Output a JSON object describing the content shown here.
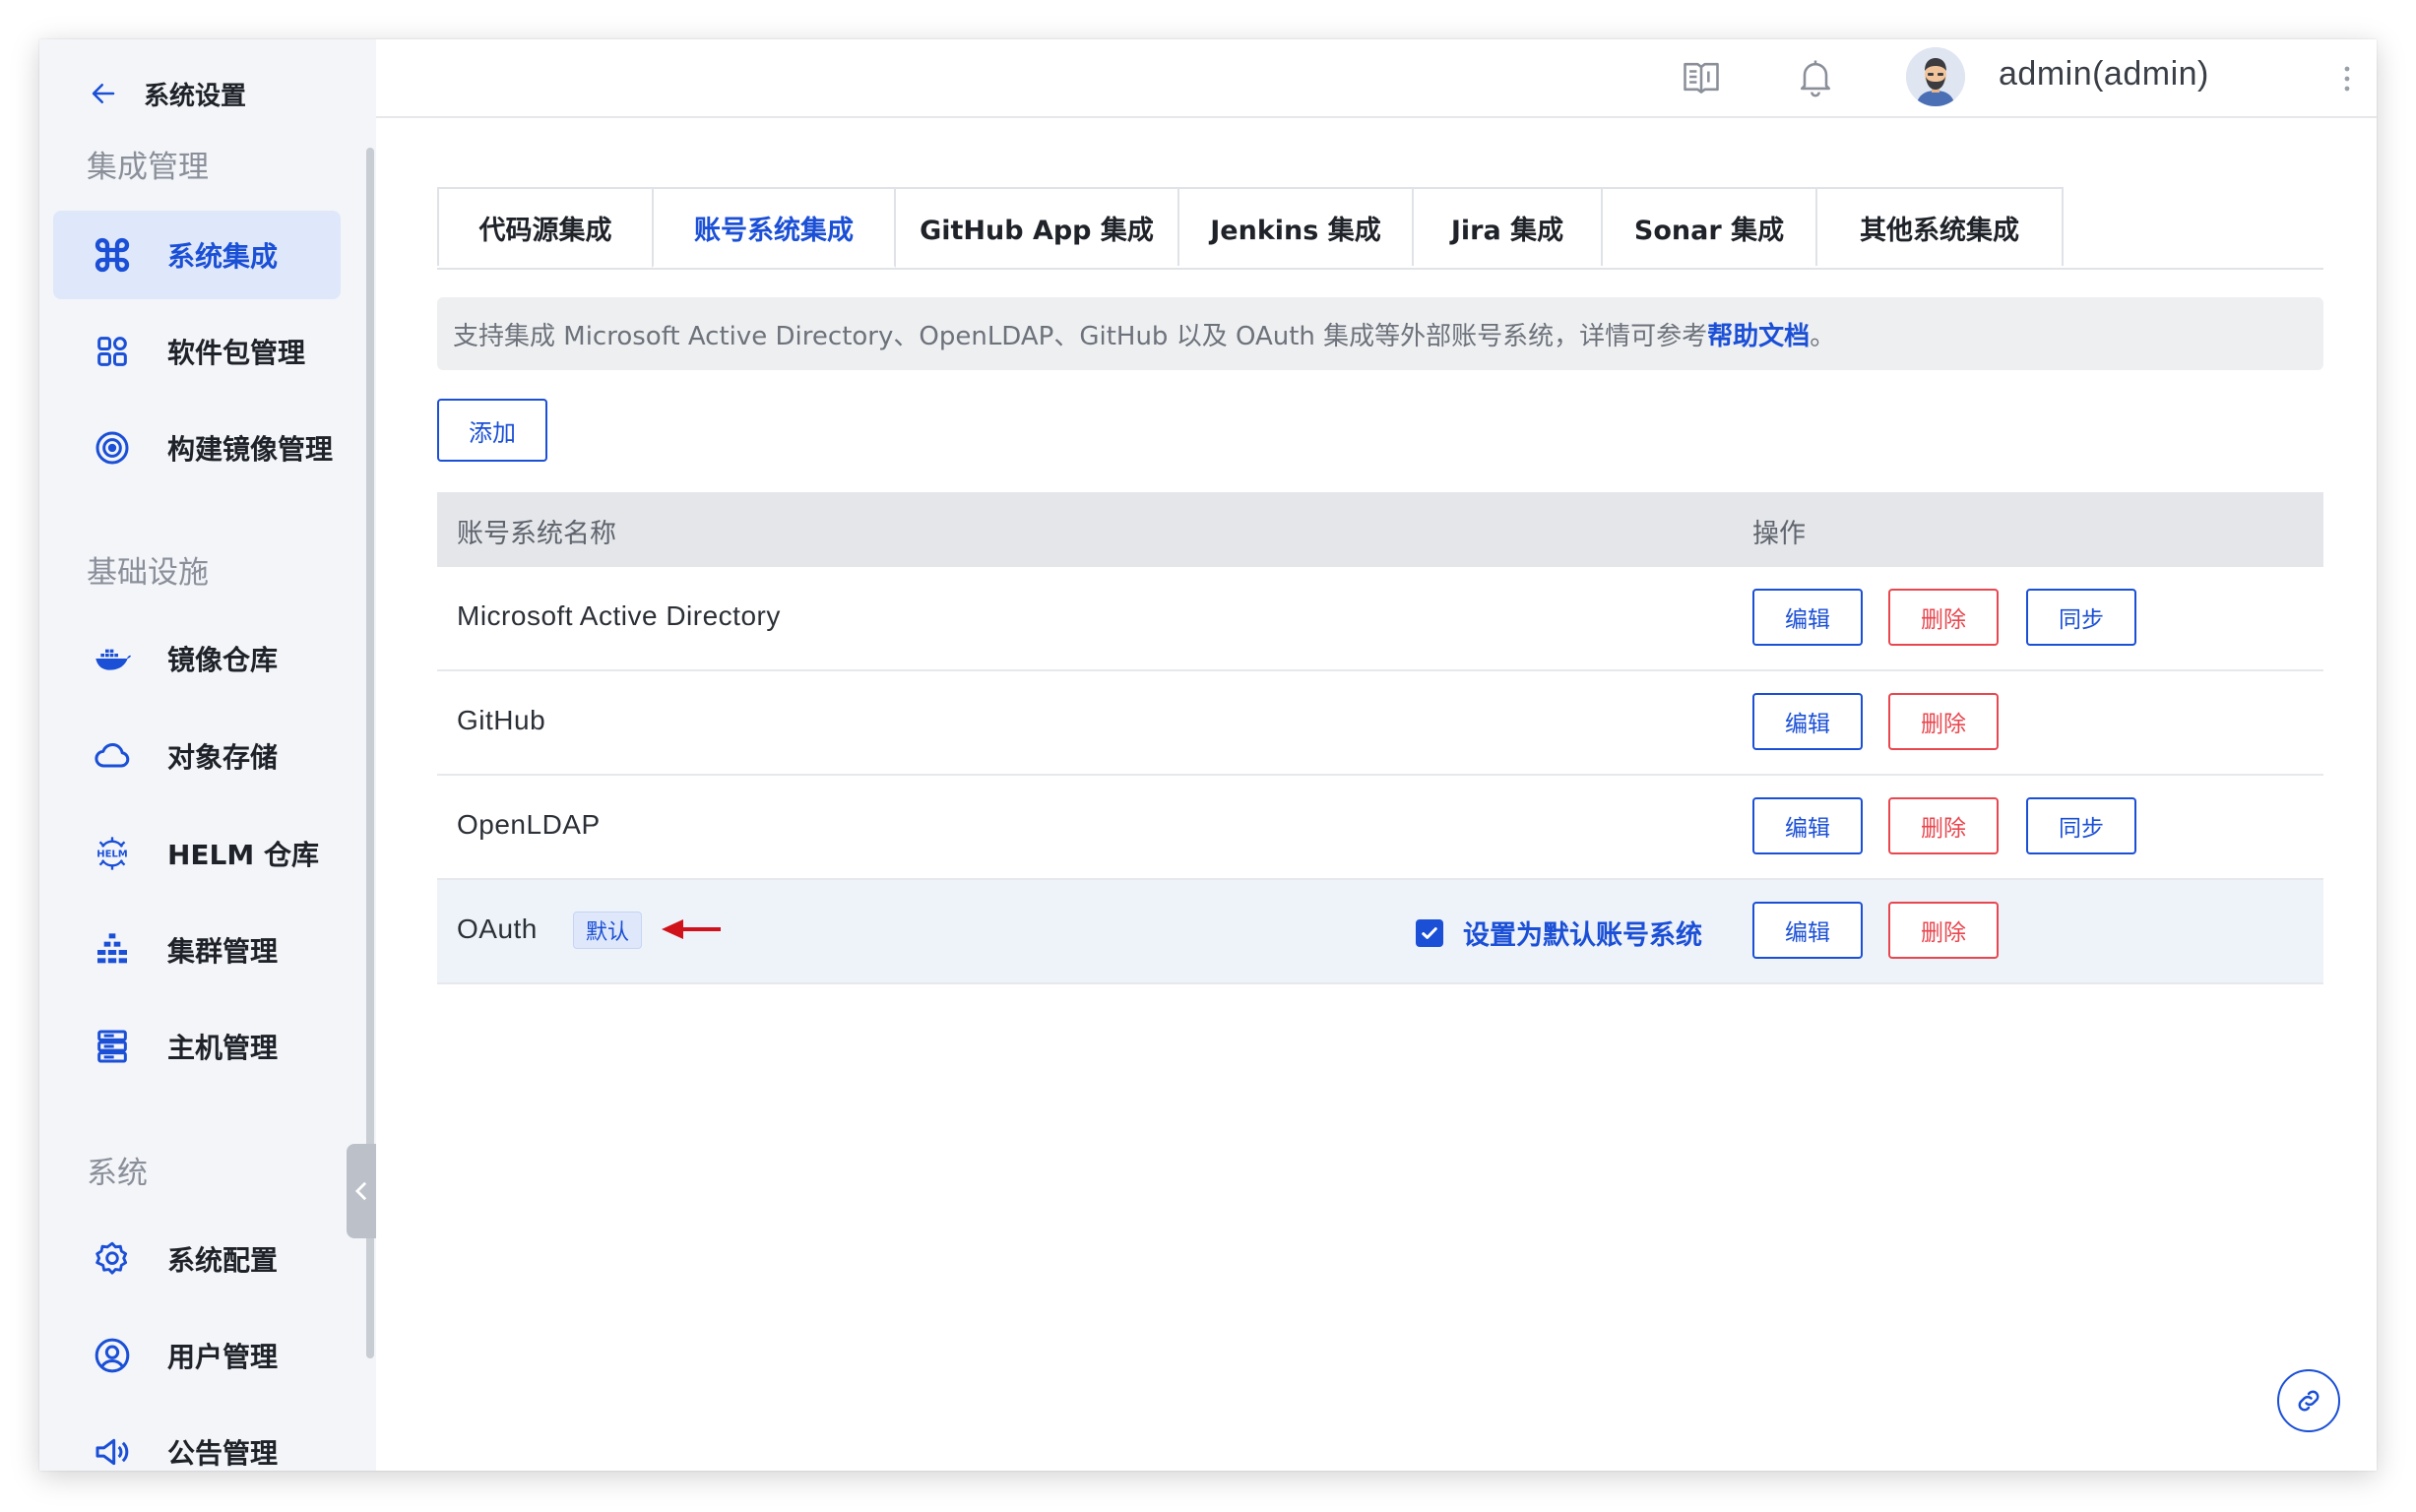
{
  "sidebar": {
    "back_label": "系统设置",
    "sections": [
      {
        "title": "集成管理"
      },
      {
        "title": "基础设施"
      },
      {
        "title": "系统"
      }
    ],
    "items": [
      {
        "label": "系统集成",
        "icon": "command-icon",
        "active": true
      },
      {
        "label": "软件包管理",
        "icon": "apps-icon"
      },
      {
        "label": "构建镜像管理",
        "icon": "disc-icon"
      },
      {
        "label": "镜像仓库",
        "icon": "docker-icon"
      },
      {
        "label": "对象存储",
        "icon": "cloud-icon"
      },
      {
        "label": "HELM 仓库",
        "icon": "helm-icon"
      },
      {
        "label": "集群管理",
        "icon": "cluster-icon"
      },
      {
        "label": "主机管理",
        "icon": "server-icon"
      },
      {
        "label": "系统配置",
        "icon": "settings-gear-icon"
      },
      {
        "label": "用户管理",
        "icon": "user-circle-icon"
      },
      {
        "label": "公告管理",
        "icon": "megaphone-icon"
      }
    ]
  },
  "header": {
    "username": "admin(admin)",
    "icons": [
      "docs-icon",
      "bell-icon",
      "avatar",
      "more-vertical-icon"
    ]
  },
  "tabs": [
    {
      "label": "代码源集成"
    },
    {
      "label": "账号系统集成",
      "active": true
    },
    {
      "label": "GitHub App 集成"
    },
    {
      "label": "Jenkins 集成"
    },
    {
      "label": "Jira 集成"
    },
    {
      "label": "Sonar 集成"
    },
    {
      "label": "其他系统集成"
    }
  ],
  "notice": {
    "text": "支持集成 Microsoft Active Directory、OpenLDAP、GitHub 以及 OAuth 集成等外部账号系统，详情可参考",
    "link": "帮助文档",
    "suffix": "。"
  },
  "add_label": "添加",
  "table": {
    "columns": [
      "账号系统名称",
      "操作"
    ],
    "rows": [
      {
        "name": "Microsoft Active Directory",
        "actions": [
          "编辑",
          "删除",
          "同步"
        ]
      },
      {
        "name": "GitHub",
        "actions": [
          "编辑",
          "删除"
        ]
      },
      {
        "name": "OpenLDAP",
        "actions": [
          "编辑",
          "删除",
          "同步"
        ]
      },
      {
        "name": "OAuth",
        "badge": "默认",
        "default_option": "设置为默认账号系统",
        "default_checked": true,
        "actions": [
          "编辑",
          "删除"
        ]
      }
    ]
  },
  "colors": {
    "accent": "#1a4fd6",
    "danger": "#e8474f",
    "sidebar_bg": "#f3f5f9",
    "arrow": "#d0121b"
  }
}
